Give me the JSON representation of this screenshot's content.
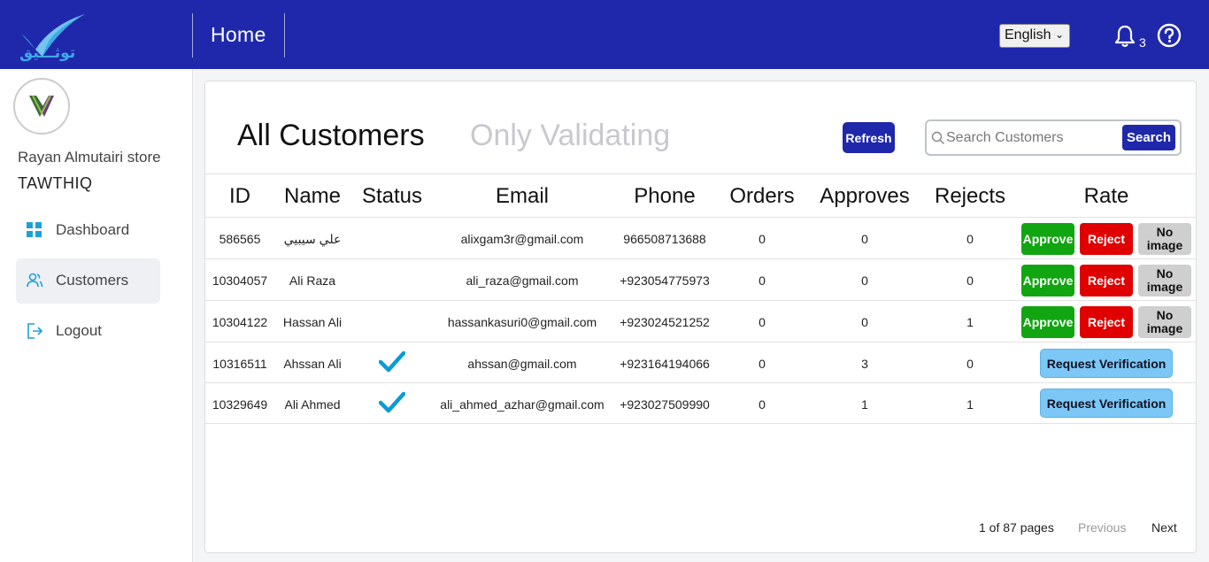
{
  "header": {
    "logo_text": "توثـــيق",
    "title": "Home",
    "language": "English",
    "notification_count": "3"
  },
  "sidebar": {
    "store_name": "Rayan Almutairi store",
    "store_brand": "TAWTHIQ",
    "items": [
      {
        "label": "Dashboard",
        "icon": "dashboard-grid-icon",
        "active": false
      },
      {
        "label": "Customers",
        "icon": "users-icon",
        "active": true
      },
      {
        "label": "Logout",
        "icon": "logout-icon",
        "active": false
      }
    ]
  },
  "main": {
    "tabs": [
      {
        "label": "All Customers",
        "active": true
      },
      {
        "label": "Only Validating",
        "active": false
      }
    ],
    "refresh_label": "Refresh",
    "search": {
      "placeholder": "Search Customers",
      "value": "",
      "button_label": "Search"
    },
    "columns": [
      "ID",
      "Name",
      "Status",
      "Email",
      "Phone",
      "Orders",
      "Approves",
      "Rejects",
      "Rate"
    ],
    "rows": [
      {
        "id": "586565",
        "name": "علي سيبيي",
        "verified": false,
        "email": "alixgam3r@gmail.com",
        "phone": "966508713688",
        "orders": "0",
        "approves": "0",
        "rejects": "0",
        "actions": "rate"
      },
      {
        "id": "10304057",
        "name": "Ali Raza",
        "verified": false,
        "email": "ali_raza@gmail.com",
        "phone": "+923054775973",
        "orders": "0",
        "approves": "0",
        "rejects": "0",
        "actions": "rate"
      },
      {
        "id": "10304122",
        "name": "Hassan Ali",
        "verified": false,
        "email": "hassankasuri0@gmail.com",
        "phone": "+923024521252",
        "orders": "0",
        "approves": "0",
        "rejects": "1",
        "actions": "rate"
      },
      {
        "id": "10316511",
        "name": "Ahssan Ali",
        "verified": true,
        "email": "ahssan@gmail.com",
        "phone": "+923164194066",
        "orders": "0",
        "approves": "3",
        "rejects": "0",
        "actions": "request"
      },
      {
        "id": "10329649",
        "name": "Ali Ahmed",
        "verified": true,
        "email": "ali_ahmed_azhar@gmail.com",
        "phone": "+923027509990",
        "orders": "0",
        "approves": "1",
        "rejects": "1",
        "actions": "request"
      }
    ],
    "rate_buttons": {
      "approve": "Approve",
      "reject": "Reject",
      "no_image_line1": "No",
      "no_image_line2": "image"
    },
    "request_verification_label": "Request Verification",
    "pagination": {
      "info": "1 of 87 pages",
      "previous": "Previous",
      "next": "Next"
    }
  },
  "colors": {
    "brand": "#1f28aa",
    "approve": "#12a512",
    "reject": "#e00000",
    "request": "#7cc7f5",
    "check": "#0a9bd6"
  }
}
